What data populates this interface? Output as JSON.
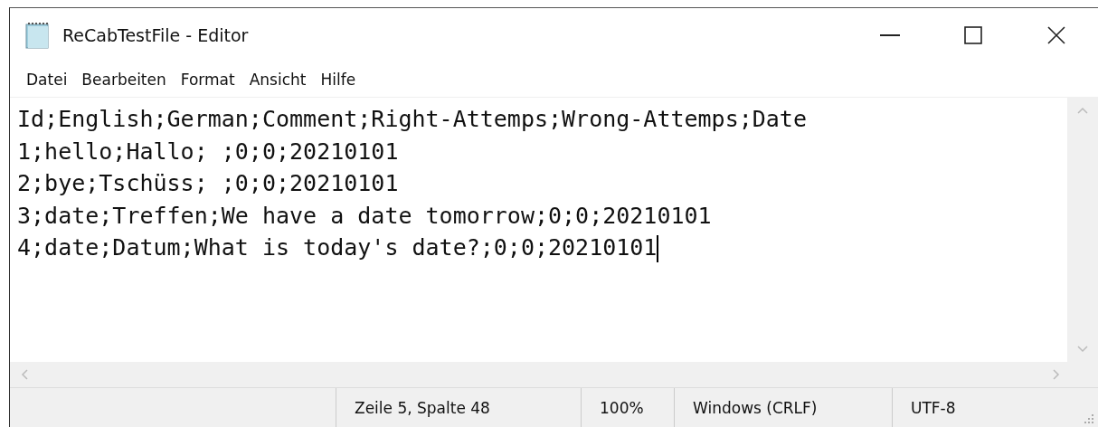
{
  "window": {
    "title": "ReCabTestFile - Editor"
  },
  "menu": [
    "Datei",
    "Bearbeiten",
    "Format",
    "Ansicht",
    "Hilfe"
  ],
  "lines": [
    "Id;English;German;Comment;Right-Attemps;Wrong-Attemps;Date",
    "1;hello;Hallo; ;0;0;20210101",
    "2;bye;Tschüss; ;0;0;20210101",
    "3;date;Treffen;We have a date tomorrow;0;0;20210101",
    "4;date;Datum;What is today's date?;0;0;20210101"
  ],
  "status_bar": [
    "Zeile 5, Spalte 48",
    "100%",
    "Windows (CRLF)",
    "UTF-8"
  ]
}
